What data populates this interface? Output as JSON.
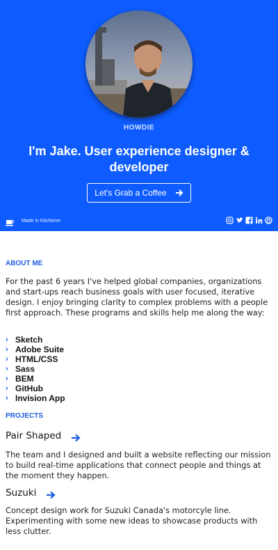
{
  "hero": {
    "eyebrow": "HOWDIE",
    "headline": "I'm Jake. User experience designer & developer",
    "cta_label": "Let's Grab a Coffee",
    "footer_text": "Made in Kitchener",
    "social_icons": [
      "instagram-icon",
      "twitter-icon",
      "facebook-icon",
      "linkedin-icon",
      "github-icon"
    ],
    "colors": {
      "background": "#0e5cff",
      "text": "#ffffff"
    }
  },
  "about": {
    "title": "ABOUT ME",
    "text": "For the past 6 years I've helped global companies, organizations and start-ups reach business goals with user focused, iterative design. I enjoy bringing clarity to complex problems with a people first approach. These programs and skills help me along the way:",
    "skills": [
      "Sketch",
      "Adobe Suite",
      "HTML/CSS",
      "Sass",
      "BEM",
      "GitHub",
      "Invision App"
    ]
  },
  "projects": {
    "title": "PROJECTS",
    "items": [
      {
        "name": "Pair Shaped",
        "text": "The team and I designed and built a website reflecting our mission to build real-time applications that connect people and things at the moment they happen."
      },
      {
        "name": "Suzuki",
        "text": "Concept design work for Suzuki Canada's motorcyle line. Experimenting with some new ideas to showcase products with less clutter."
      }
    ],
    "accent": "#1f5fe0"
  }
}
